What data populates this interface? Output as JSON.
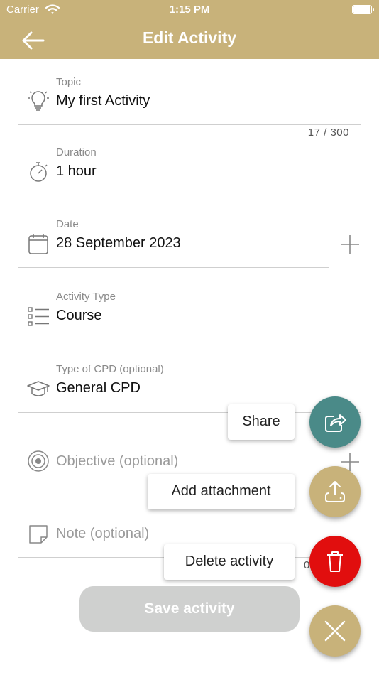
{
  "status_bar": {
    "carrier": "Carrier",
    "time": "1:15 PM"
  },
  "header": {
    "title": "Edit Activity",
    "back_icon": "arrow-left-icon"
  },
  "fields": {
    "topic": {
      "label": "Topic",
      "value": "My first Activity",
      "counter": "17 / 300",
      "icon": "lightbulb-icon"
    },
    "duration": {
      "label": "Duration",
      "value": "1 hour",
      "icon": "stopwatch-icon"
    },
    "date": {
      "label": "Date",
      "value": "28 September 2023",
      "icon": "calendar-icon"
    },
    "activity_type": {
      "label": "Activity Type",
      "value": "Course",
      "icon": "list-icon"
    },
    "cpd_type": {
      "label": "Type of CPD (optional)",
      "value": "General CPD",
      "icon": "graduation-cap-icon"
    },
    "objective": {
      "placeholder": "Objective (optional)",
      "icon": "target-icon"
    },
    "note": {
      "placeholder": "Note (optional)",
      "icon": "note-icon",
      "counter_partial": "0"
    }
  },
  "save_button": {
    "label": "Save activity"
  },
  "speed_dial": {
    "share": {
      "label": "Share",
      "color": "#4a8a88",
      "icon": "share-icon"
    },
    "attachment": {
      "label": "Add attachment",
      "color": "#c8b27a",
      "icon": "upload-icon"
    },
    "delete": {
      "label": "Delete activity",
      "color": "#e10e0e",
      "icon": "trash-icon"
    },
    "close": {
      "color": "#c8b27a",
      "icon": "close-icon"
    }
  },
  "colors": {
    "brand": "#c8b27a",
    "divider": "#cfcfcf",
    "disabled_button": "#cfd0cf"
  }
}
